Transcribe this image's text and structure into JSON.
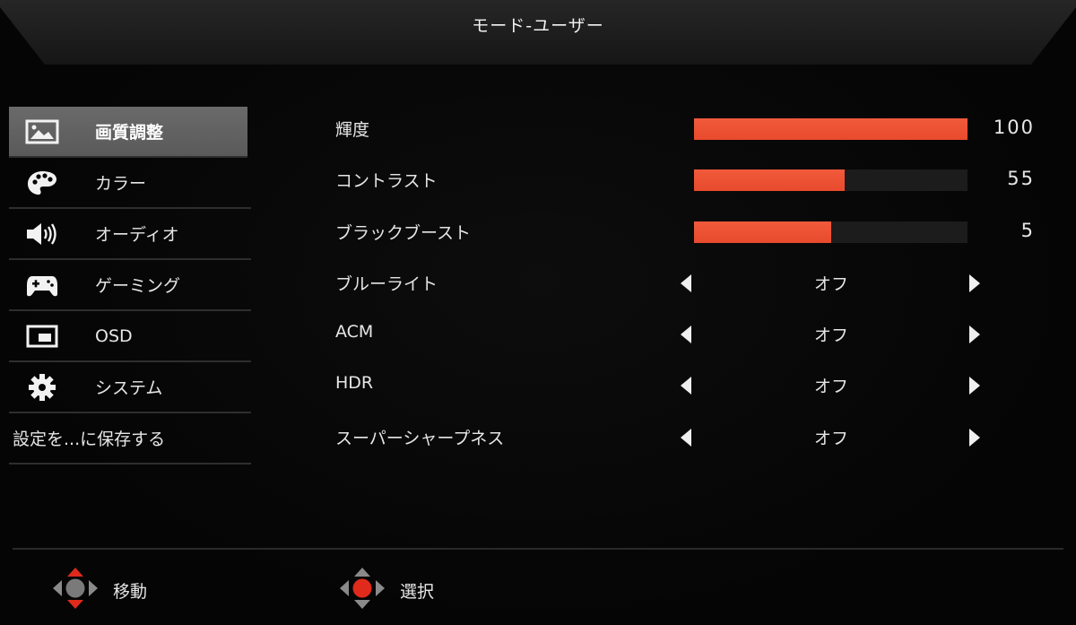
{
  "header": {
    "title": "モード-ユーザー"
  },
  "sidebar": {
    "items": [
      {
        "label": "画質調整",
        "icon": "picture-icon",
        "active": true
      },
      {
        "label": "カラー",
        "icon": "palette-icon",
        "active": false
      },
      {
        "label": "オーディオ",
        "icon": "speaker-icon",
        "active": false
      },
      {
        "label": "ゲーミング",
        "icon": "gamepad-icon",
        "active": false
      },
      {
        "label": "OSD",
        "icon": "osd-window-icon",
        "active": false
      },
      {
        "label": "システム",
        "icon": "gear-icon",
        "active": false
      }
    ],
    "save_label": "設定を...に保存する"
  },
  "settings": {
    "sliders": [
      {
        "label": "輝度",
        "value": "100",
        "percent": 100
      },
      {
        "label": "コントラスト",
        "value": "55",
        "percent": 55
      },
      {
        "label": "ブラックブースト",
        "value": "5",
        "percent": 50
      }
    ],
    "options": [
      {
        "label": "ブルーライト",
        "value": "オフ"
      },
      {
        "label": "ACM",
        "value": "オフ"
      },
      {
        "label": "HDR",
        "value": "オフ"
      },
      {
        "label": "スーパーシャープネス",
        "value": "オフ"
      }
    ]
  },
  "footer": {
    "move_label": "移動",
    "move_icon": "dpad-move-icon",
    "select_label": "選択",
    "select_icon": "dpad-select-icon"
  },
  "colors": {
    "accent": "#e84a2c",
    "active_item": "#5e5e5e",
    "background": "#050505"
  }
}
